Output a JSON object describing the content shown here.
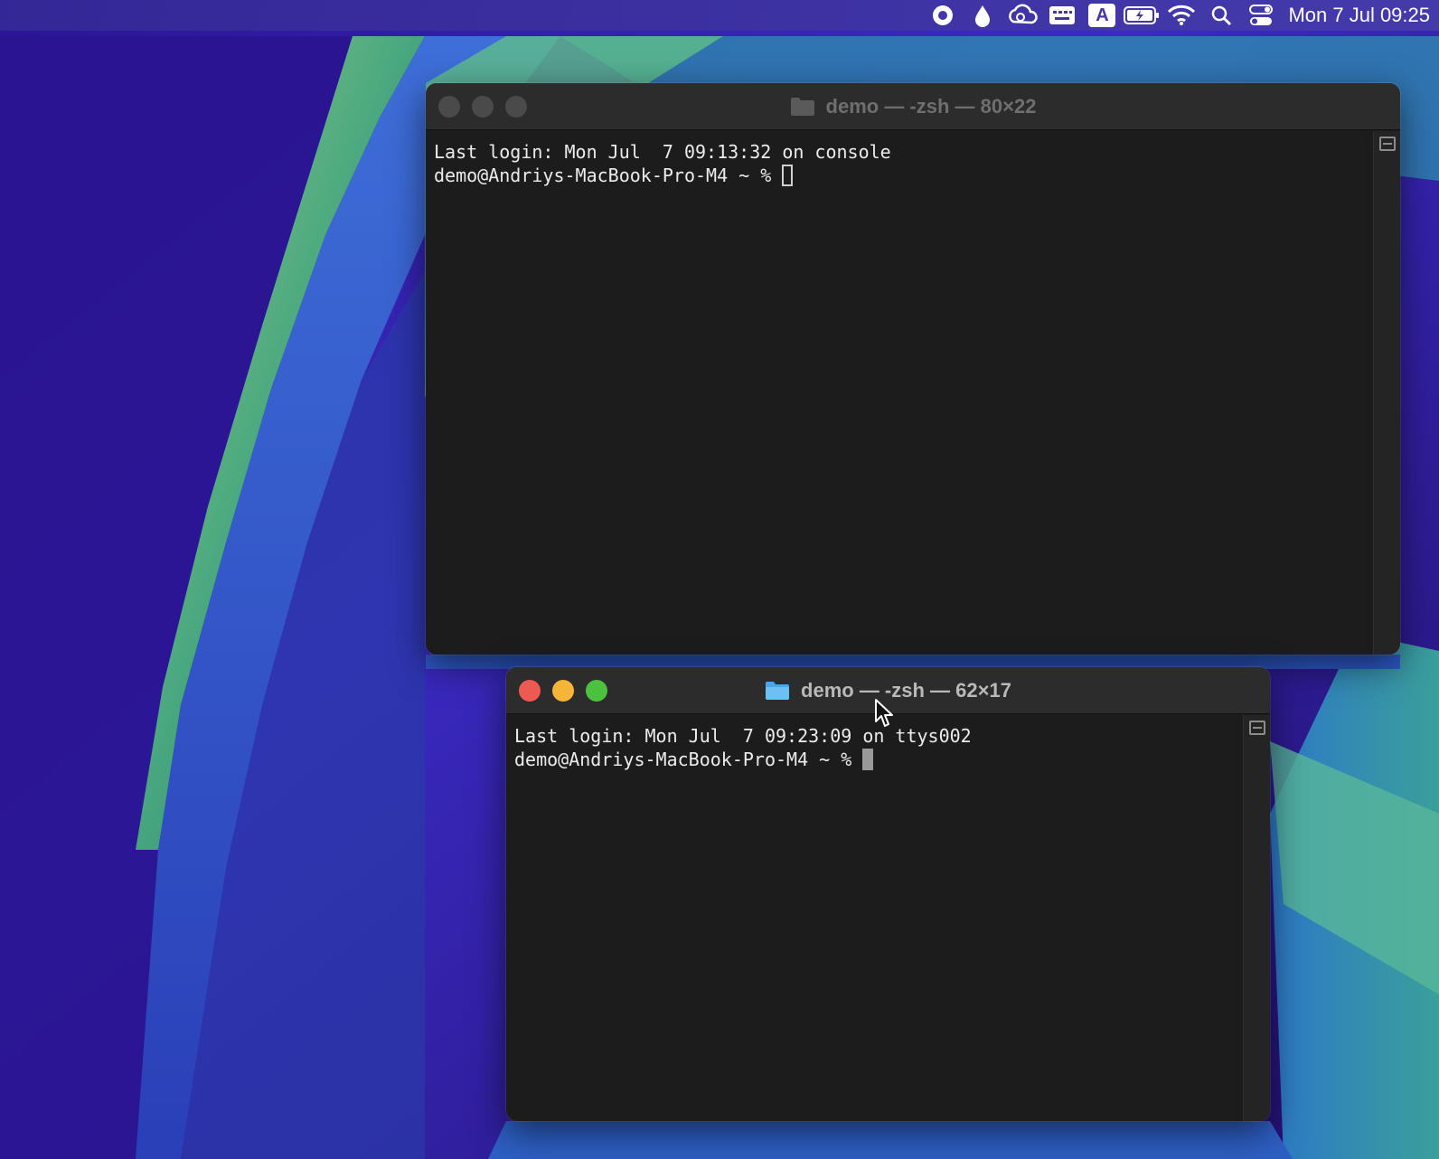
{
  "menubar": {
    "icons": [
      "record-icon",
      "drop-icon",
      "creative-cloud-icon",
      "keyboard-icon",
      "input-source-icon",
      "battery-icon",
      "wifi-icon",
      "search-icon",
      "control-center-icon"
    ],
    "input_source_label": "A",
    "clock": "Mon 7 Jul  09:25"
  },
  "window_back": {
    "title": "demo — -zsh — 80×22",
    "lines": [
      "Last login: Mon Jul  7 09:13:32 on console",
      "demo@Andriys-MacBook-Pro-M4 ~ % "
    ],
    "active": false
  },
  "window_front": {
    "title": "demo — -zsh — 62×17",
    "lines": [
      "Last login: Mon Jul  7 09:23:09 on ttys002",
      "demo@Andriys-MacBook-Pro-M4 ~ % "
    ],
    "active": true
  },
  "colors": {
    "close": "#ee5a52",
    "minimize": "#f5b538",
    "maximize": "#4cc13f",
    "terminal_bg": "#1c1c1c",
    "folder": "#4aa8e8"
  }
}
